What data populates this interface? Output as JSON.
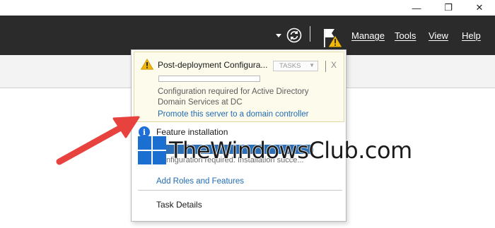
{
  "window": {
    "controls": {
      "minimize": "—",
      "maximize": "❐",
      "close": "✕"
    }
  },
  "toolbar": {
    "manage": "Manage",
    "tools": "Tools",
    "view": "View",
    "help": "Help"
  },
  "notifications": {
    "post_deployment": {
      "title": "Post-deployment Configura...",
      "tasks_label": "TASKS",
      "close_label": "X",
      "description": "Configuration required for Active Directory Domain Services at DC",
      "link": "Promote this server to a domain controller"
    },
    "feature_installation": {
      "title": "Feature installation",
      "partial_text": "Configuration required. Installation succe...",
      "link": "Add Roles and Features"
    },
    "task_details": "Task Details"
  },
  "watermark": {
    "text": "TheWindowsClub.com"
  },
  "colors": {
    "toolbar_bg": "#2b2b2b",
    "link": "#1f6bb3",
    "warning": "#f2b705",
    "info": "#1e6fd9",
    "arrow": "#e8423f"
  }
}
